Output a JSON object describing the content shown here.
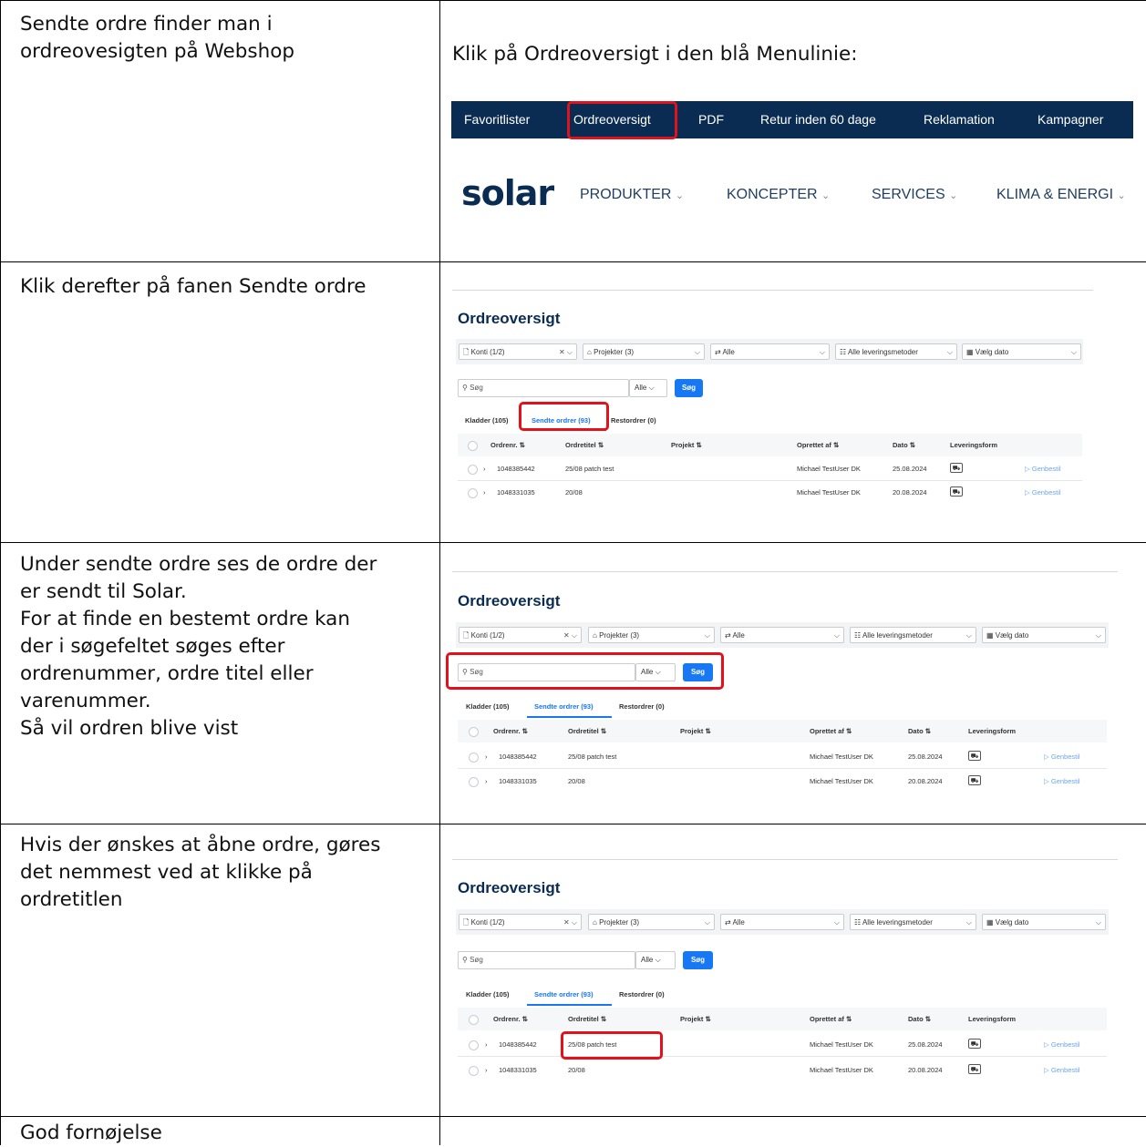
{
  "rows": [
    {
      "left_text": "Sendte ordre finder man i\nordreovesigten på Webshop",
      "right_text": "Klik på Ordreoversigt i den blå Menulinie:"
    },
    {
      "left_text": "Klik derefter på fanen Sendte ordre"
    },
    {
      "left_text": "Under sendte ordre ses de ordre der\ner sendt til Solar.\nFor at finde en bestemt ordre kan\nder i søgefeltet søges efter\nordrenummer, ordre titel eller\nvarenummer.\nSå vil ordren blive vist"
    },
    {
      "left_text": "Hvis der ønskes at åbne ordre, gøres\ndet nemmest ved at klikke på\nordretitlen"
    },
    {
      "left_text": "God fornøjelse"
    }
  ],
  "menubar": {
    "items": [
      "Favoritlister",
      "Ordreoversigt",
      "PDF",
      "Retur inden 60 dage",
      "Reklamation",
      "Kampagner"
    ]
  },
  "site": {
    "logo": "solar",
    "nav": [
      "PRODUKTER",
      "KONCEPTER",
      "SERVICES",
      "KLIMA & ENERGI"
    ]
  },
  "order": {
    "title": "Ordreoversigt",
    "filters": {
      "konti": "Konti (1/2)",
      "projekter": "Projekter (3)",
      "alle": "Alle",
      "levering": "Alle leveringsmetoder",
      "dato": "Vælg dato"
    },
    "search_placeholder": "Søg",
    "search_scope": "Alle",
    "search_button": "Søg",
    "tabs": [
      "Kladder (105)",
      "Sendte ordrer (93)",
      "Restordrer (0)"
    ],
    "columns": [
      "Ordrenr. ⇅",
      "Ordretitel ⇅",
      "Projekt ⇅",
      "Oprettet af ⇅",
      "Dato ⇅",
      "Leveringsform"
    ],
    "orders": [
      {
        "nr": "1048385442",
        "title": "25/08 patch test",
        "by": "Michael TestUser DK",
        "date": "25.08.2024",
        "action": "Genbestil"
      },
      {
        "nr": "1048331035",
        "title": "20/08",
        "by": "Michael TestUser DK",
        "date": "20.08.2024",
        "action": "Genbestil"
      }
    ]
  },
  "colors": {
    "menubar": "#0a2c52",
    "highlight": "#e1121b",
    "accent": "#1877f2"
  }
}
